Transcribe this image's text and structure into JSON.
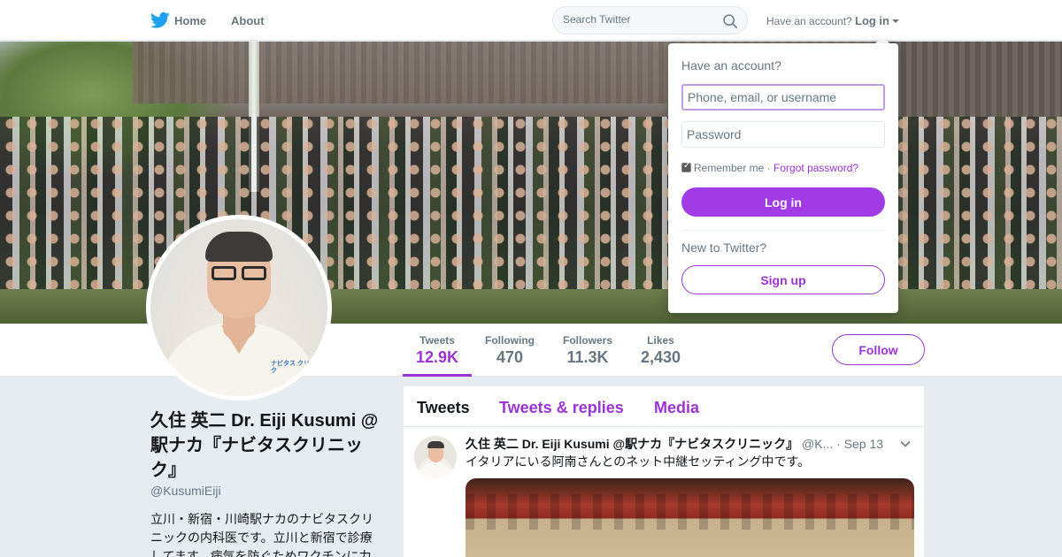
{
  "nav": {
    "home_label": "Home",
    "about_label": "About",
    "search_placeholder": "Search Twitter",
    "have_account": "Have an account?",
    "login_label": "Log in",
    "brand_color": "#1da1f2"
  },
  "profile": {
    "name": "久住 英二 Dr. Eiji Kusumi @駅ナカ『ナビタスクリニック』",
    "handle": "@KusumiEiji",
    "bio": "立川・新宿・川崎駅ナカのナビタスクリニックの内科医です。立川と新宿で診療してます。病気を防ぐためワクチンに力",
    "avatar_logo": "ナビタス クリニック",
    "follow_label": "Follow",
    "accent_color": "#9c34d4"
  },
  "stats": [
    {
      "label": "Tweets",
      "value": "12.9K",
      "active": true
    },
    {
      "label": "Following",
      "value": "470",
      "active": false
    },
    {
      "label": "Followers",
      "value": "11.3K",
      "active": false
    },
    {
      "label": "Likes",
      "value": "2,430",
      "active": false
    }
  ],
  "timeline": {
    "tabs": [
      "Tweets",
      "Tweets & replies",
      "Media"
    ],
    "active_tab": "Tweets",
    "tweet": {
      "name": "久住 英二 Dr. Eiji Kusumi @駅ナカ『ナビタスクリニック』",
      "handle": "@K...",
      "time": "Sep 13",
      "text": "イタリアにいる阿南さんとのネット中継セッティング中です。"
    }
  },
  "login_dropdown": {
    "title": "Have an account?",
    "username_placeholder": "Phone, email, or username",
    "password_placeholder": "Password",
    "remember_label": "Remember me",
    "separator": "·",
    "forgot_label": "Forgot password?",
    "remember_checked": true,
    "login_button": "Log in",
    "new_prompt": "New to Twitter?",
    "signup_button": "Sign up"
  },
  "icons": {
    "bird": "twitter-bird-icon",
    "search": "search-icon",
    "caret": "caret-down-icon",
    "chevron": "chevron-down-icon"
  }
}
